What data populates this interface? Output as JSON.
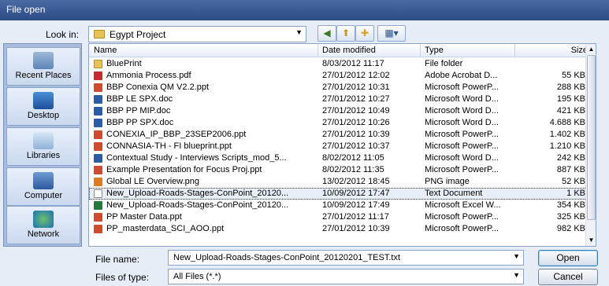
{
  "window": {
    "title": "File open"
  },
  "lookin": {
    "label": "Look in:",
    "value": "Egypt Project"
  },
  "places": [
    {
      "label": "Recent Places",
      "icon": "recent-places-icon"
    },
    {
      "label": "Desktop",
      "icon": "desktop-icon"
    },
    {
      "label": "Libraries",
      "icon": "libraries-icon"
    },
    {
      "label": "Computer",
      "icon": "computer-icon"
    },
    {
      "label": "Network",
      "icon": "network-icon"
    }
  ],
  "columns": {
    "name": "Name",
    "date": "Date modified",
    "type": "Type",
    "size": "Size"
  },
  "files": [
    {
      "name": "BluePrint",
      "date": "8/03/2012 11:17",
      "type": "File folder",
      "size": "",
      "icon": "folder"
    },
    {
      "name": "Ammonia Process.pdf",
      "date": "27/01/2012 12:02",
      "type": "Adobe Acrobat D...",
      "size": "55 KB",
      "icon": "pdf"
    },
    {
      "name": "BBP Conexia QM V2.2.ppt",
      "date": "27/01/2012 10:31",
      "type": "Microsoft PowerP...",
      "size": "288 KB",
      "icon": "ppt"
    },
    {
      "name": "BBP LE SPX.doc",
      "date": "27/01/2012 10:27",
      "type": "Microsoft Word D...",
      "size": "195 KB",
      "icon": "doc"
    },
    {
      "name": "BBP PP MIP.doc",
      "date": "27/01/2012 10:49",
      "type": "Microsoft Word D...",
      "size": "421 KB",
      "icon": "doc"
    },
    {
      "name": "BBP PP SPX.doc",
      "date": "27/01/2012 10:26",
      "type": "Microsoft Word D...",
      "size": "4.688 KB",
      "icon": "doc"
    },
    {
      "name": "CONEXIA_IP_BBP_23SEP2006.ppt",
      "date": "27/01/2012 10:39",
      "type": "Microsoft PowerP...",
      "size": "1.402 KB",
      "icon": "ppt"
    },
    {
      "name": "CONNASIA-TH - FI blueprint.ppt",
      "date": "27/01/2012 10:37",
      "type": "Microsoft PowerP...",
      "size": "1.210 KB",
      "icon": "ppt"
    },
    {
      "name": "Contextual Study - Interviews Scripts_mod_5...",
      "date": "8/02/2012 11:05",
      "type": "Microsoft Word D...",
      "size": "242 KB",
      "icon": "doc"
    },
    {
      "name": "Example Presentation for Focus Proj.ppt",
      "date": "8/02/2012 11:35",
      "type": "Microsoft PowerP...",
      "size": "887 KB",
      "icon": "ppt"
    },
    {
      "name": "Global LE Overview.png",
      "date": "13/02/2012 18:45",
      "type": "PNG image",
      "size": "52 KB",
      "icon": "png"
    },
    {
      "name": "New_Upload-Roads-Stages-ConPoint_20120...",
      "date": "10/09/2012 17:47",
      "type": "Text Document",
      "size": "1 KB",
      "icon": "txt",
      "selected": true
    },
    {
      "name": "New_Upload-Roads-Stages-ConPoint_20120...",
      "date": "10/09/2012 17:49",
      "type": "Microsoft Excel W...",
      "size": "354 KB",
      "icon": "xls"
    },
    {
      "name": "PP Master Data.ppt",
      "date": "27/01/2012 11:17",
      "type": "Microsoft PowerP...",
      "size": "325 KB",
      "icon": "ppt"
    },
    {
      "name": "PP_masterdata_SCI_AOO.ppt",
      "date": "27/01/2012 10:39",
      "type": "Microsoft PowerP...",
      "size": "982 KB",
      "icon": "ppt"
    }
  ],
  "filename": {
    "label": "File name:",
    "value": "New_Upload-Roads-Stages-ConPoint_20120201_TEST.txt"
  },
  "filetype": {
    "label": "Files of type:",
    "value": "All Files (*.*)"
  },
  "buttons": {
    "open": "Open",
    "cancel": "Cancel"
  }
}
